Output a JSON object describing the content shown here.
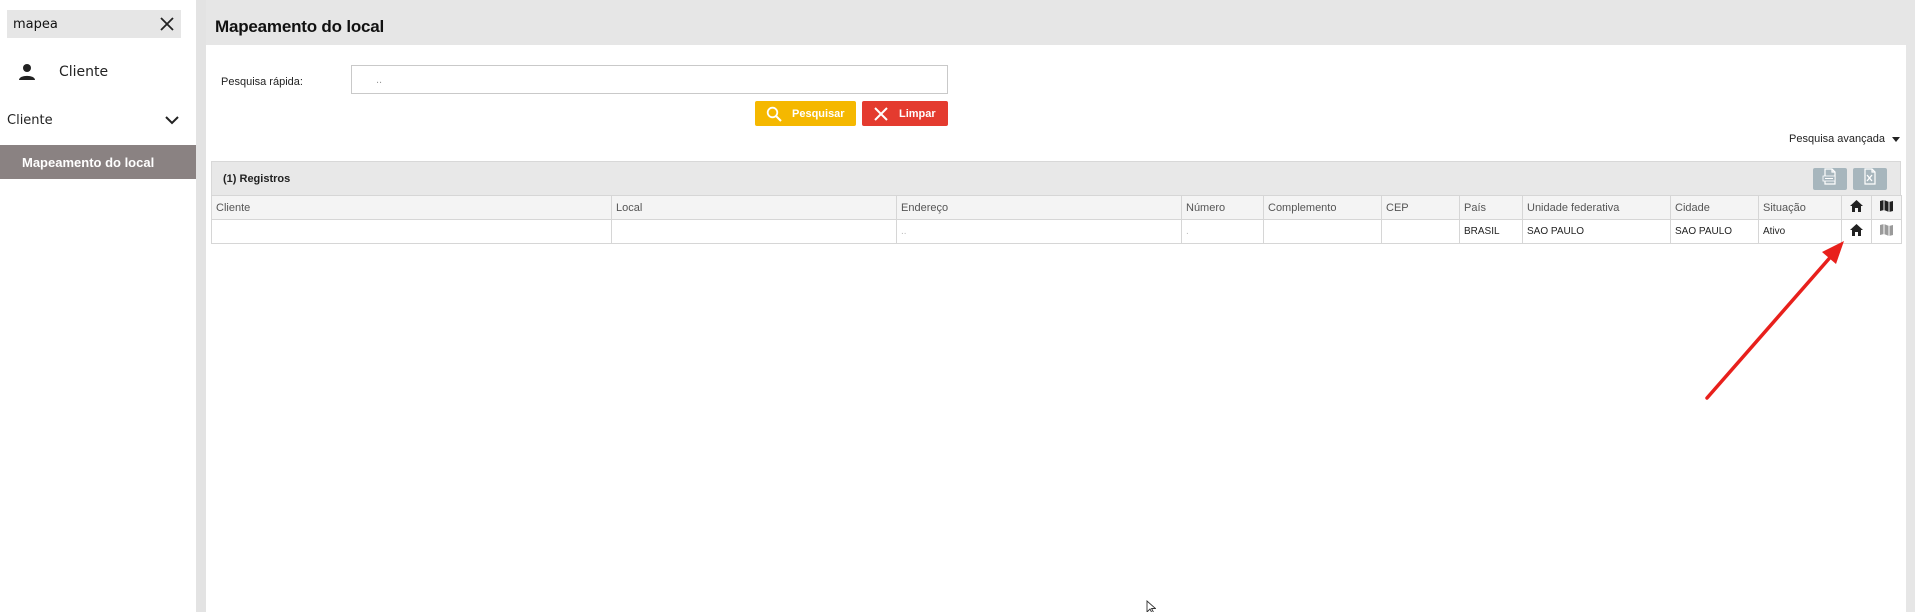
{
  "sidebar": {
    "search_value": "mapea",
    "profile_label": "Cliente",
    "group_label": "Cliente",
    "active_item_label": "Mapeamento do local"
  },
  "page": {
    "title": "Mapeamento do local"
  },
  "quick_search": {
    "label": "Pesquisa rápida:",
    "value": "..",
    "search_button": "Pesquisar",
    "clear_button": "Limpar"
  },
  "advanced_search_label": "Pesquisa avançada",
  "grid": {
    "records_label": "(1) Registros",
    "export_buttons": [
      "csv-export-icon",
      "xls-export-icon"
    ],
    "columns": [
      "Cliente",
      "Local",
      "Endereço",
      "Número",
      "Complemento",
      "CEP",
      "País",
      "Unidade federativa",
      "Cidade",
      "Situação"
    ],
    "icon_columns": [
      "home-icon",
      "map-icon"
    ],
    "rows": [
      {
        "cliente": "",
        "local": "",
        "endereco": "..",
        "numero": ".",
        "complemento": "",
        "cep": "",
        "pais": "BRASIL",
        "uf": "SAO PAULO",
        "cidade": "SAO PAULO",
        "situacao": "Ativo"
      }
    ]
  },
  "colors": {
    "search_button": "#f5b800",
    "clear_button": "#e43b2f",
    "active_menu": "#8a8282",
    "annotation_arrow": "#e8201c"
  }
}
